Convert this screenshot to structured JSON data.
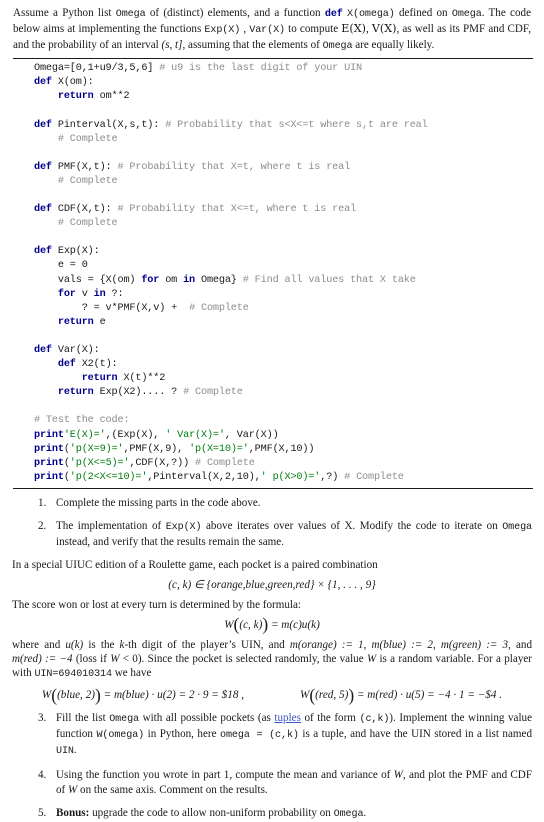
{
  "document": {
    "intro": {
      "line_parts": [
        "Assume a Python list ",
        "Omega",
        " of (distinct) elements, and a function ",
        "def",
        " X(omega)",
        " defined on ",
        "Omega",
        ". The code below aims at implementing the functions ",
        "Exp(X)",
        " , ",
        "Var(X)",
        " to compute ",
        "E(X)",
        ", ",
        "V(X)",
        ", as well as its PMF and CDF, and the probability of an interval ",
        "(s,t]",
        ", assuming that the elements of ",
        "Omega",
        " are equally likely."
      ],
      "omega_tt": "Omega",
      "def_kw": "def",
      "x_omega_tt": "X(omega)",
      "exp_tt": "Exp(X)",
      "var_tt": "Var(X)",
      "e_of_x": "E(X)",
      "v_of_x": "V(X)",
      "interval": "(s, t]"
    },
    "code": {
      "language": "python",
      "lines": [
        [
          {
            "t": "Omega=[0,1+u9/3,5,6] ",
            "c": "pl"
          },
          {
            "t": "# u9 is the last digit of your UIN",
            "c": "cm"
          }
        ],
        [
          {
            "t": "def",
            "c": "k"
          },
          {
            "t": " X(om):",
            "c": "pl"
          }
        ],
        [
          {
            "t": "    ",
            "c": "pl"
          },
          {
            "t": "return",
            "c": "k"
          },
          {
            "t": " om**2",
            "c": "pl"
          }
        ],
        [
          {
            "t": "",
            "c": "pl"
          }
        ],
        [
          {
            "t": "def",
            "c": "k"
          },
          {
            "t": " Pinterval(X,s,t): ",
            "c": "pl"
          },
          {
            "t": "# Probability that s<X<=t where s,t are real",
            "c": "cm"
          }
        ],
        [
          {
            "t": "    ",
            "c": "pl"
          },
          {
            "t": "# Complete",
            "c": "cm"
          }
        ],
        [
          {
            "t": "",
            "c": "pl"
          }
        ],
        [
          {
            "t": "def",
            "c": "k"
          },
          {
            "t": " PMF(X,t): ",
            "c": "pl"
          },
          {
            "t": "# Probability that X=t, where t is real",
            "c": "cm"
          }
        ],
        [
          {
            "t": "    ",
            "c": "pl"
          },
          {
            "t": "# Complete",
            "c": "cm"
          }
        ],
        [
          {
            "t": "",
            "c": "pl"
          }
        ],
        [
          {
            "t": "def",
            "c": "k"
          },
          {
            "t": " CDF(X,t): ",
            "c": "pl"
          },
          {
            "t": "# Probability that X<=t, where t is real",
            "c": "cm"
          }
        ],
        [
          {
            "t": "    ",
            "c": "pl"
          },
          {
            "t": "# Complete",
            "c": "cm"
          }
        ],
        [
          {
            "t": "",
            "c": "pl"
          }
        ],
        [
          {
            "t": "def",
            "c": "k"
          },
          {
            "t": " Exp(X):",
            "c": "pl"
          }
        ],
        [
          {
            "t": "    e = 0",
            "c": "pl"
          }
        ],
        [
          {
            "t": "    vals = {X(om) ",
            "c": "pl"
          },
          {
            "t": "for",
            "c": "k"
          },
          {
            "t": " om ",
            "c": "pl"
          },
          {
            "t": "in",
            "c": "k"
          },
          {
            "t": " Omega} ",
            "c": "pl"
          },
          {
            "t": "# Find all values that X take",
            "c": "cm"
          }
        ],
        [
          {
            "t": "    ",
            "c": "pl"
          },
          {
            "t": "for",
            "c": "k"
          },
          {
            "t": " v ",
            "c": "pl"
          },
          {
            "t": "in",
            "c": "k"
          },
          {
            "t": " ?:",
            "c": "pl"
          }
        ],
        [
          {
            "t": "        ? = v*PMF(X,v) +  ",
            "c": "pl"
          },
          {
            "t": "# Complete",
            "c": "cm"
          }
        ],
        [
          {
            "t": "    ",
            "c": "pl"
          },
          {
            "t": "return",
            "c": "k"
          },
          {
            "t": " e",
            "c": "pl"
          }
        ],
        [
          {
            "t": "",
            "c": "pl"
          }
        ],
        [
          {
            "t": "def",
            "c": "k"
          },
          {
            "t": " Var(X):",
            "c": "pl"
          }
        ],
        [
          {
            "t": "    ",
            "c": "pl"
          },
          {
            "t": "def",
            "c": "k"
          },
          {
            "t": " X2(t):",
            "c": "pl"
          }
        ],
        [
          {
            "t": "        ",
            "c": "pl"
          },
          {
            "t": "return",
            "c": "k"
          },
          {
            "t": " X(t)**2",
            "c": "pl"
          }
        ],
        [
          {
            "t": "    ",
            "c": "pl"
          },
          {
            "t": "return",
            "c": "k"
          },
          {
            "t": " Exp(X2).... ? ",
            "c": "pl"
          },
          {
            "t": "# Complete",
            "c": "cm"
          }
        ],
        [
          {
            "t": "",
            "c": "pl"
          }
        ],
        [
          {
            "t": "# Test the code:",
            "c": "cm"
          }
        ],
        [
          {
            "t": "print",
            "c": "k"
          },
          {
            "t": "'E(X)='",
            "c": "st"
          },
          {
            "t": ",(Exp(X), ",
            "c": "pl"
          },
          {
            "t": "' Var(X)='",
            "c": "st"
          },
          {
            "t": ", Var(X))",
            "c": "pl"
          }
        ],
        [
          {
            "t": "print",
            "c": "k"
          },
          {
            "t": "(",
            "c": "pl"
          },
          {
            "t": "'p(X=9)='",
            "c": "st"
          },
          {
            "t": ",PMF(X,9), ",
            "c": "pl"
          },
          {
            "t": "'p(X=10)='",
            "c": "st"
          },
          {
            "t": ",PMF(X,10))",
            "c": "pl"
          }
        ],
        [
          {
            "t": "print",
            "c": "k"
          },
          {
            "t": "(",
            "c": "pl"
          },
          {
            "t": "'p(X<=5)='",
            "c": "st"
          },
          {
            "t": ",CDF(X,?)) ",
            "c": "pl"
          },
          {
            "t": "# Complete",
            "c": "cm"
          }
        ],
        [
          {
            "t": "print",
            "c": "k"
          },
          {
            "t": "(",
            "c": "pl"
          },
          {
            "t": "'p(2<X<=10)='",
            "c": "st"
          },
          {
            "t": ",Pinterval(X,2,10),",
            "c": "pl"
          },
          {
            "t": "' p(X>0)='",
            "c": "st"
          },
          {
            "t": ",?) ",
            "c": "pl"
          },
          {
            "t": "# Complete",
            "c": "cm"
          }
        ]
      ]
    },
    "item1": {
      "text": "Complete the missing parts in the code above."
    },
    "item2": {
      "before": "The implementation of ",
      "exp_tt": "Exp(X)",
      "middle": " above iterates over values of X. Modify the code to iterate on ",
      "omega_tt": "Omega",
      "after": " instead, and verify that the results remain the same."
    },
    "roulette": {
      "intro": "In a special UIUC edition of a Roulette game, each pocket is a paired combination",
      "eq_pocket": "(c, k) ∈ {orange,blue,green,red} × {1, . . . , 9}",
      "score_intro": "The score won or lost at every turn is determined by the formula:",
      "eq_w_open": "W",
      "eq_w_arg": "(c, k)",
      "eq_w_rhs": "= m(c)u(k)",
      "where_part1": "where and ",
      "where_uk": "u(k)",
      "where_part2": " is the ",
      "where_kth": "k",
      "where_part3": "-th digit of the player’s UIN, and ",
      "m_orange": "m(orange) := 1",
      "m_blue": "m(blue) := 2",
      "m_green": "m(green) := 3",
      "m_red": "m(red) := −4",
      "loss_note": " (loss if ",
      "loss_w": "W",
      "loss_note2": " < 0). Since the pocket is selected randomly, the value ",
      "loss_w2": "W",
      "loss_note3": " is a random variable. For a player with ",
      "uin_tt": "UIN=694010314",
      "loss_note4": " we have",
      "eq_blue_w": "W",
      "eq_blue_arg": "(blue, 2)",
      "eq_blue_rhs": "= m(blue) · u(2) = 2 · 9 = $18 ,",
      "eq_red_w": "W",
      "eq_red_arg": "(red, 5)",
      "eq_red_rhs": "= m(red) · u(5) = −4 · 1 = −$4 ."
    },
    "item3": {
      "p1": "Fill the list ",
      "omega_tt": "Omega",
      "p2": " with all possible pockets (as ",
      "link": "tuples",
      "p3": " of the form ",
      "ck_tt": "(c,k)",
      "p4": "). Implement the winning value function ",
      "w_omega_tt": "W(omega)",
      "p5": " in Python, here ",
      "omega_eq_tt": "omega = (c,k)",
      "p6": " is a tuple, and have the UIN stored in a list named ",
      "uin_tt": "UIN",
      "p7": "."
    },
    "item4": {
      "p1": "Using the function you wrote in part 1, compute the mean and variance of ",
      "w1": "W",
      "p2": ", and plot the PMF and CDF of ",
      "w2": "W",
      "p3": " on the same axis. Comment on the results."
    },
    "item5": {
      "bonus_label": "Bonus:",
      "p1": " upgrade the code to allow non-uniform probability on ",
      "omega_tt": "Omega",
      "p2": "."
    }
  },
  "colors": {
    "keyword": "#00008b",
    "comment": "#8c8c8c",
    "string": "#007d0f",
    "text": "#1a1a1a",
    "link": "#3a54c4",
    "background": "#ffffff"
  }
}
